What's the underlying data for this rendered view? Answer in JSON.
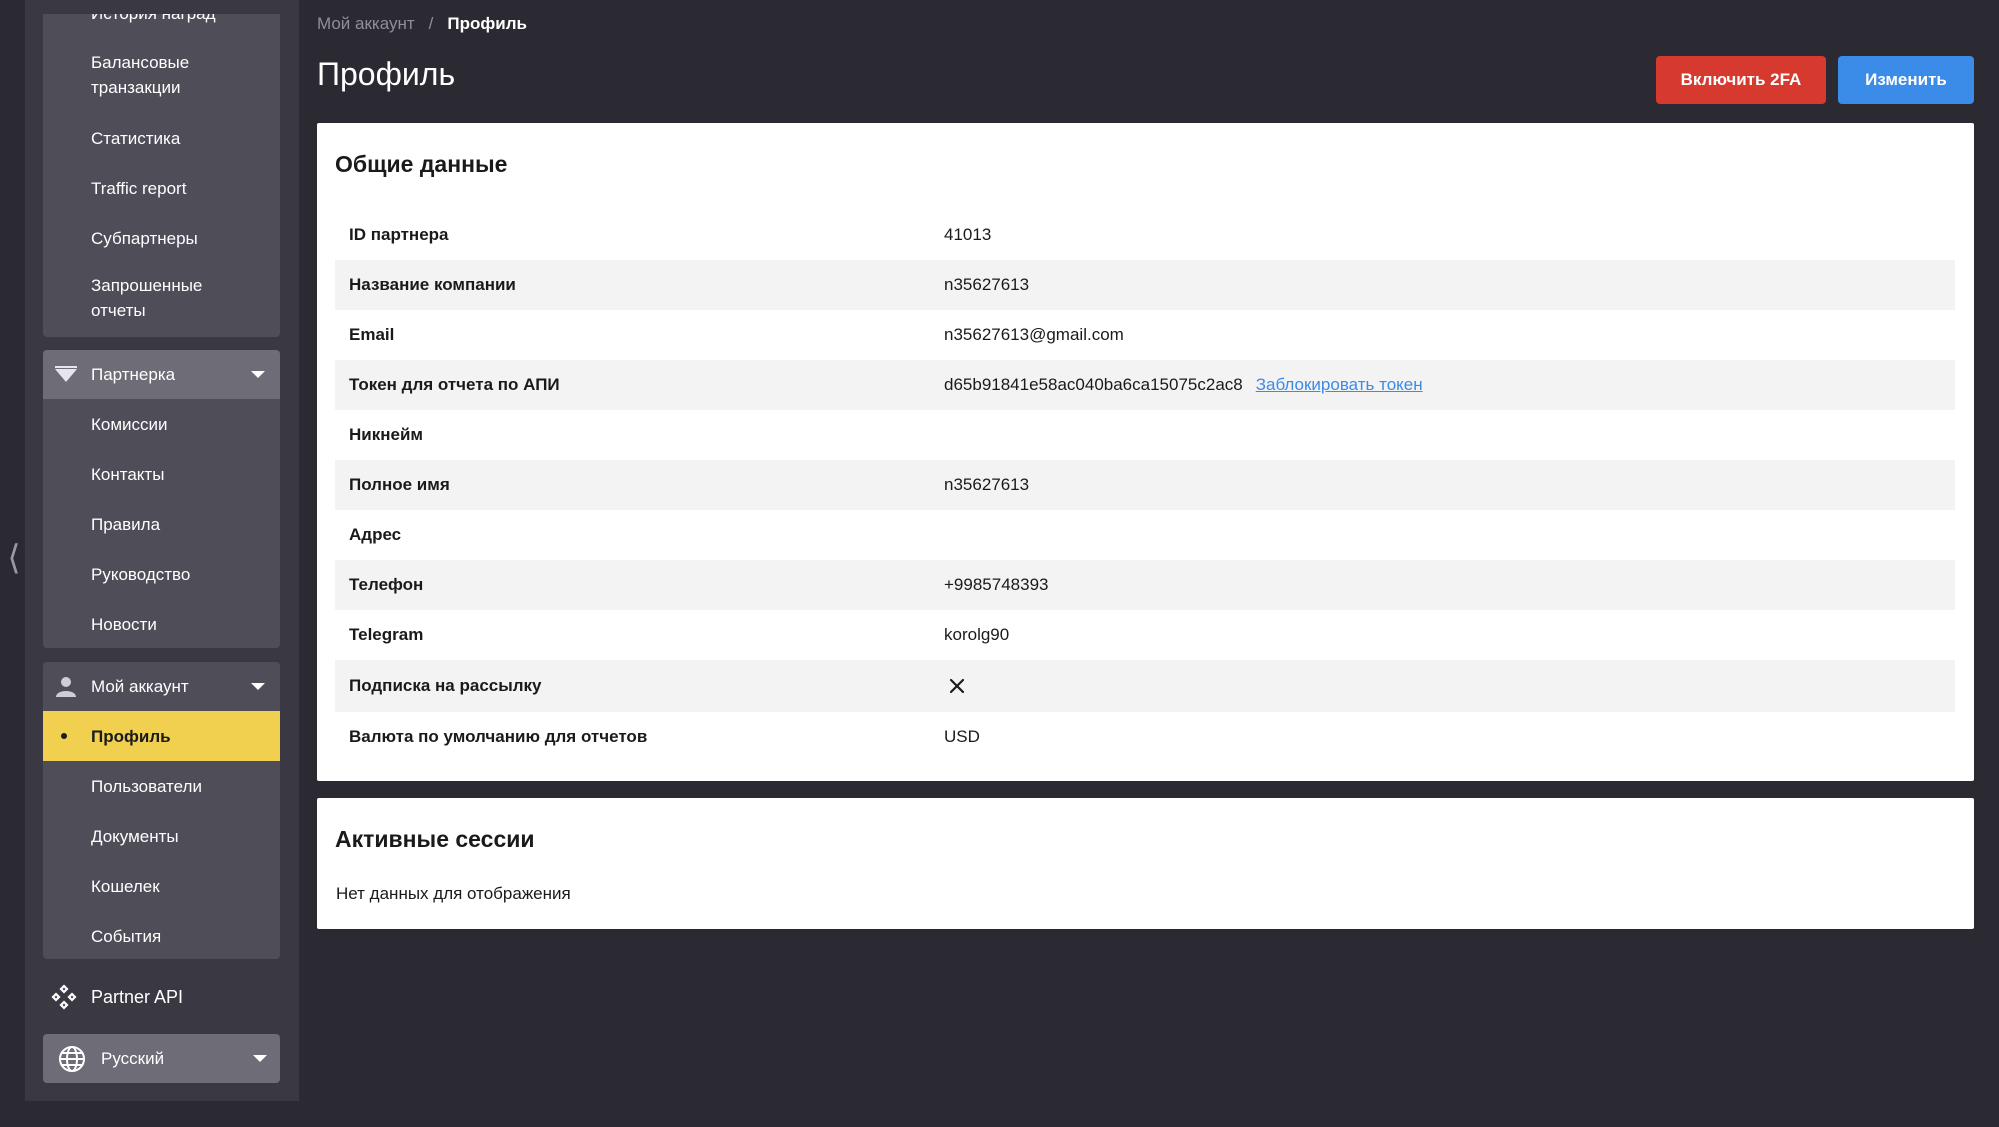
{
  "sidebar": {
    "reports_group": {
      "items": [
        {
          "label": "История наград"
        },
        {
          "label": "Балансовые транзакции"
        },
        {
          "label": "Статистика"
        },
        {
          "label": "Traffic report"
        },
        {
          "label": "Субпартнеры"
        },
        {
          "label": "Запрошенные отчеты"
        }
      ]
    },
    "partnership_group": {
      "title": "Партнерка",
      "items": [
        {
          "label": "Комиссии"
        },
        {
          "label": "Контакты"
        },
        {
          "label": "Правила"
        },
        {
          "label": "Руководство"
        },
        {
          "label": "Новости"
        }
      ]
    },
    "account_group": {
      "title": "Мой аккаунт",
      "items": [
        {
          "label": "Профиль",
          "active": true
        },
        {
          "label": "Пользователи"
        },
        {
          "label": "Документы"
        },
        {
          "label": "Кошелек"
        },
        {
          "label": "События"
        }
      ]
    },
    "partner_api": "Partner API",
    "language": "Русский"
  },
  "breadcrumb": {
    "parent": "Мой аккаунт",
    "separator": "/",
    "current": "Профиль"
  },
  "page": {
    "title": "Профиль",
    "enable_2fa_label": "Включить 2FA",
    "edit_label": "Изменить"
  },
  "general": {
    "title": "Общие данные",
    "rows": [
      {
        "label": "ID партнера",
        "value": "41013"
      },
      {
        "label": "Название компании",
        "value": "n35627613"
      },
      {
        "label": "Email",
        "value": "n35627613@gmail.com"
      },
      {
        "label": "Токен для отчета по АПИ",
        "value": "d65b91841e58ac040ba6ca15075c2ac8",
        "link": "Заблокировать токен"
      },
      {
        "label": "Никнейм",
        "value": ""
      },
      {
        "label": "Полное имя",
        "value": "n35627613"
      },
      {
        "label": "Адрес",
        "value": ""
      },
      {
        "label": "Телефон",
        "value": "+9985748393"
      },
      {
        "label": "Telegram",
        "value": "korolg90"
      },
      {
        "label": "Подписка на рассылку",
        "value": "",
        "icon": "x-icon"
      },
      {
        "label": "Валюта по умолчанию для отчетов",
        "value": "USD"
      }
    ]
  },
  "sessions": {
    "title": "Активные сессии",
    "empty_text": "Нет данных для отображения"
  },
  "colors": {
    "sidebar_bg": "#3a3943",
    "app_bg": "#2b2a32",
    "active_item": "#f1cf4f",
    "danger_button": "#d63a2f",
    "primary_button": "#3b8be8",
    "link": "#3b8be8"
  }
}
